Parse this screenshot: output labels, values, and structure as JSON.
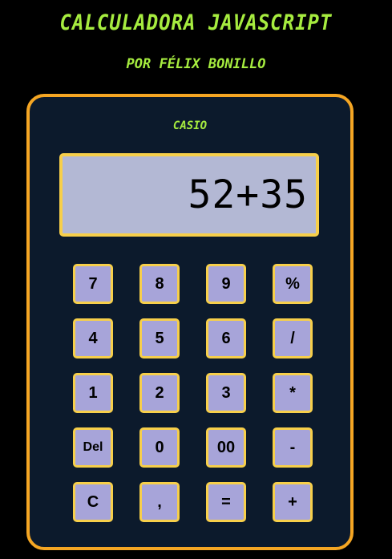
{
  "header": {
    "title": "Calculadora JavaScript",
    "subtitle": "Por Félix Bonillo"
  },
  "calculator": {
    "brand": "Casio",
    "display": "52+35",
    "keys": [
      [
        "7",
        "8",
        "9",
        "%"
      ],
      [
        "4",
        "5",
        "6",
        "/"
      ],
      [
        "1",
        "2",
        "3",
        "*"
      ],
      [
        "Del",
        "0",
        "00",
        "-"
      ],
      [
        "C",
        ",",
        "=",
        "+"
      ]
    ]
  },
  "colors": {
    "background": "#000000",
    "accent_green": "#a6ec3f",
    "frame_orange": "#f5a623",
    "body": "#0c1a2c",
    "key_fill": "#a7a4d9",
    "key_border": "#f7cf4a",
    "display_fill": "#b3b8d4"
  }
}
